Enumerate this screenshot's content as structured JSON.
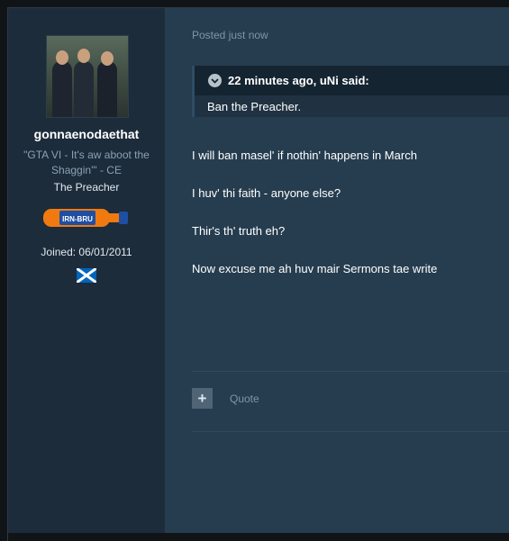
{
  "post": {
    "posted_label": "Posted just now",
    "quote": {
      "author_line": "22 minutes ago, uNi said:",
      "body": "Ban the Preacher."
    },
    "lines": [
      "I will ban masel' if nothin' happens in March",
      "I huv' thi faith - anyone else?",
      "Thir's th' truth eh?",
      "Now excuse me ah huv mair Sermons tae write"
    ],
    "actions": {
      "plus_symbol": "+",
      "quote_label": "Quote"
    }
  },
  "author": {
    "username": "gonnaenodaethat",
    "title": "\"GTA VI - It's aw aboot the Shaggin'\" - CE",
    "rank": "The Preacher",
    "badge_text": "IRN-BRU",
    "joined": "Joined: 06/01/2011",
    "flag_icon": "scotland-flag-icon"
  },
  "colors": {
    "sidebar": "#1c2c3b",
    "content": "#263d4f",
    "quote_header": "#152431",
    "badge_orange": "#f07a10",
    "badge_blue": "#1f4fa3",
    "flag_blue": "#0065bd"
  }
}
